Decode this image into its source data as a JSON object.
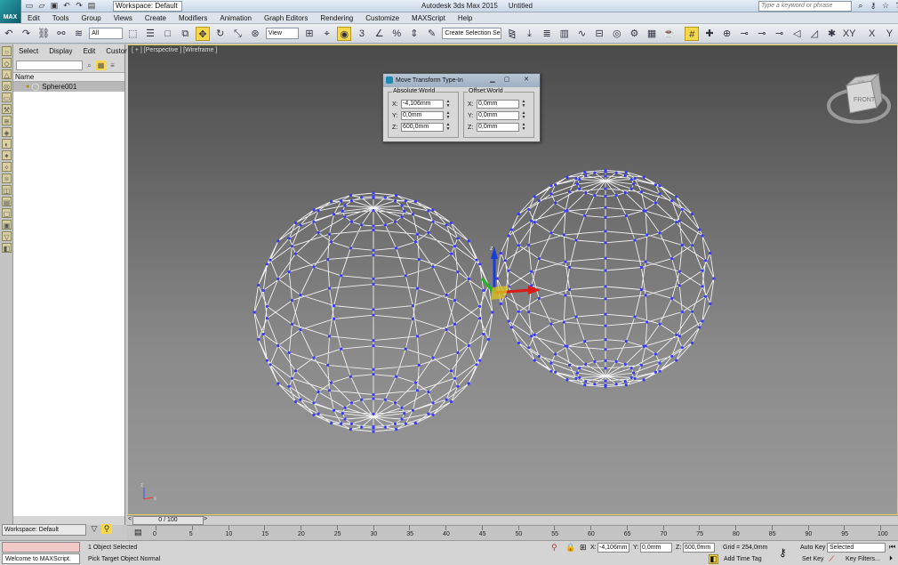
{
  "app": {
    "logo_text": "MAX",
    "title": "Autodesk 3ds Max 2015",
    "document": "Untitled",
    "workspace": "Workspace: Default",
    "search_placeholder": "Type a keyword or phrase"
  },
  "menu": [
    "Edit",
    "Tools",
    "Group",
    "Views",
    "Create",
    "Modifiers",
    "Animation",
    "Graph Editors",
    "Rendering",
    "Customize",
    "MAXScript",
    "Help"
  ],
  "toolbar": {
    "selection_filter": "All",
    "ref_coord": "View",
    "named_selection": "Create Selection Se",
    "axis_labels": [
      "XY",
      "X",
      "Y"
    ],
    "snap_label": "3"
  },
  "scene_explorer": {
    "tabs": [
      "Select",
      "Display",
      "Edit",
      "Customize"
    ],
    "column_header": "Name",
    "objects": [
      "Sphere001"
    ]
  },
  "viewport": {
    "label": "[ + ] [Perspective ] [Wireframe ]",
    "viewcube_face": "FRONT",
    "viewcube_top": "TOP",
    "axis_y": "y",
    "axis_z": "z",
    "axis_x": "x"
  },
  "dialog": {
    "title": "Move Transform Type-In",
    "absolute_label": "Absolute:World",
    "offset_label": "Offset:World",
    "absolute": {
      "x": "-4,106mm",
      "y": "0,0mm",
      "z": "600,0mm"
    },
    "offset": {
      "x": "0,0mm",
      "y": "0,0mm",
      "z": "0,0mm"
    },
    "axis_labels": [
      "X:",
      "Y:",
      "Z:"
    ]
  },
  "timeline": {
    "frame_display": "0 / 100",
    "ticks": [
      "0",
      "5",
      "10",
      "15",
      "20",
      "25",
      "30",
      "35",
      "40",
      "45",
      "50",
      "55",
      "60",
      "65",
      "70",
      "75",
      "80",
      "85",
      "90",
      "95",
      "100"
    ]
  },
  "status": {
    "workspace": "Workspace: Default",
    "maxscript": "Welcome to MAXScript.",
    "selection": "1 Object Selected",
    "prompt": "Pick Target Object Normal",
    "coord_x": "-4,106mm",
    "coord_y": "0,0mm",
    "coord_z": "600,0mm",
    "grid": "Grid = 254,0mm",
    "add_time_tag": "Add Time Tag",
    "auto_key": "Auto Key",
    "set_key": "Set Key",
    "key_mode": "Selected",
    "key_filters": "Key Filters..."
  }
}
